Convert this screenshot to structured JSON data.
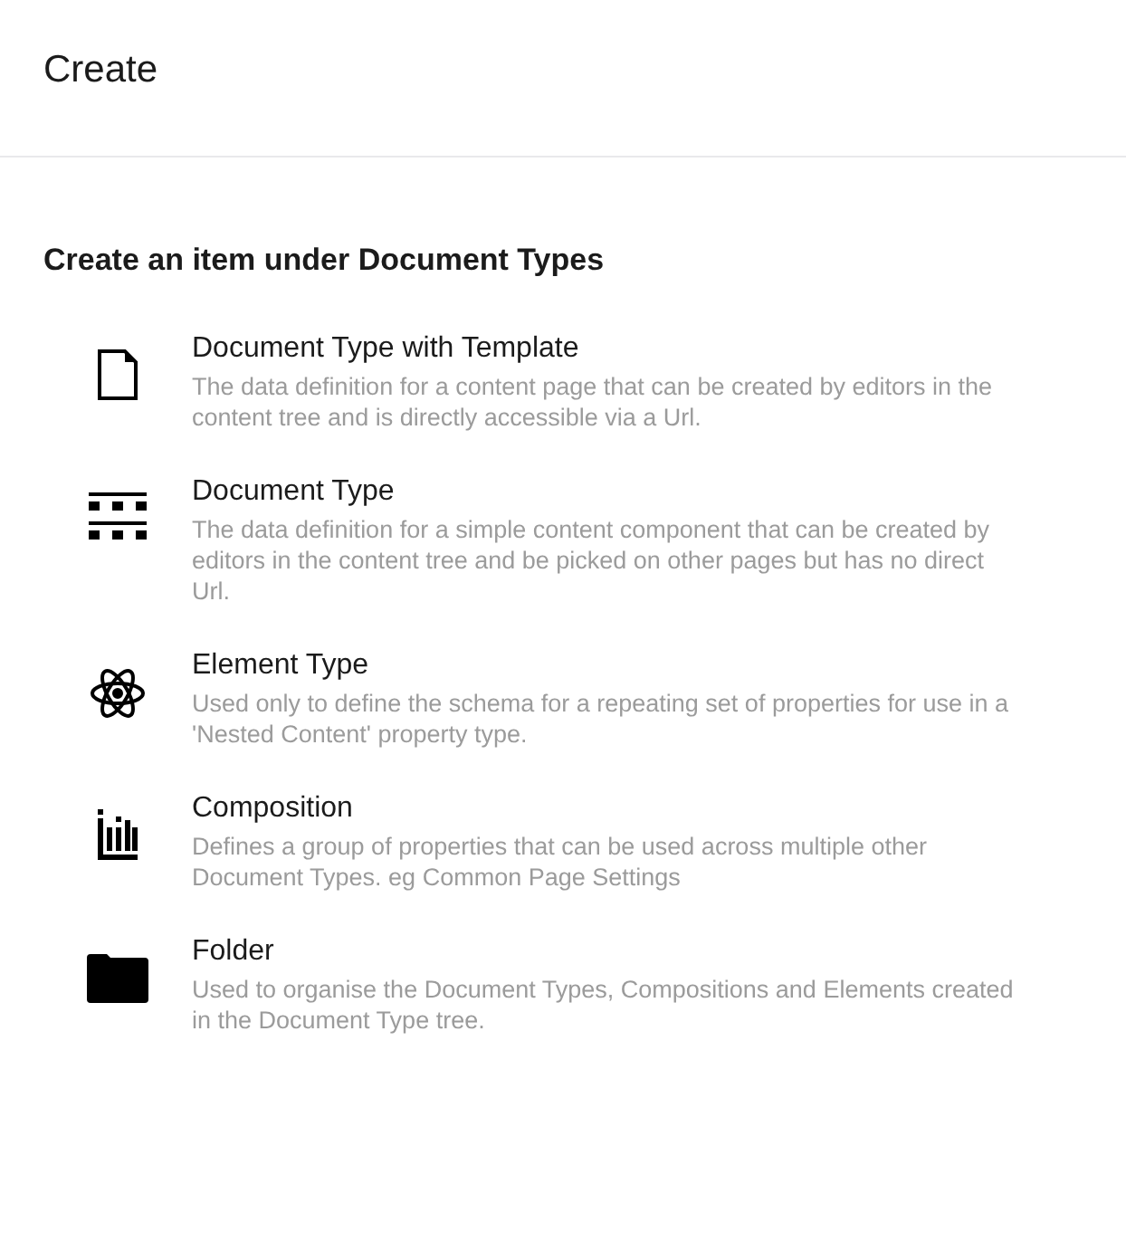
{
  "header": {
    "title": "Create"
  },
  "section": {
    "heading": "Create an item under Document Types"
  },
  "items": [
    {
      "kind": "document",
      "title": "Document Type with Template",
      "description": "The data definition for a content page that can be created by editors in the content tree and is directly accessible via a Url."
    },
    {
      "kind": "list",
      "title": "Document Type",
      "description": "The data definition for a simple content component that can be created by editors in the content tree and be picked on other pages but has no direct Url."
    },
    {
      "kind": "atom",
      "title": "Element Type",
      "description": "Used only to define the schema for a repeating set of properties for use in a 'Nested Content' property type."
    },
    {
      "kind": "chart",
      "title": "Composition",
      "description": "Defines a group of properties that can be used across multiple other Document Types. eg Common Page Settings"
    },
    {
      "kind": "folder",
      "title": "Folder",
      "description": "Used to organise the Document Types, Compositions and Elements created in the Document Type tree."
    }
  ]
}
